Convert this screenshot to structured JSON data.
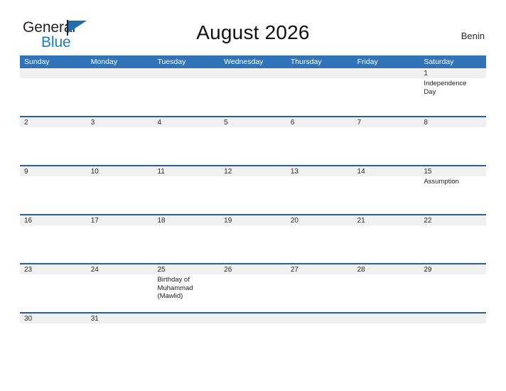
{
  "branding": {
    "logo_primary": "General",
    "logo_secondary": "Blue",
    "color_primary": "#231f20",
    "color_secondary": "#1a7dc4",
    "flag_color": "#1f6cb0"
  },
  "header": {
    "title": "August 2026",
    "country": "Benin"
  },
  "colors": {
    "header_blue": "#3173b8",
    "separator_blue": "#2a5f9e",
    "date_band_gray": "#f0f0f0"
  },
  "calendar": {
    "weekdays": [
      "Sunday",
      "Monday",
      "Tuesday",
      "Wednesday",
      "Thursday",
      "Friday",
      "Saturday"
    ],
    "weeks": [
      {
        "short": false,
        "days": [
          {
            "num": "",
            "event": ""
          },
          {
            "num": "",
            "event": ""
          },
          {
            "num": "",
            "event": ""
          },
          {
            "num": "",
            "event": ""
          },
          {
            "num": "",
            "event": ""
          },
          {
            "num": "",
            "event": ""
          },
          {
            "num": "1",
            "event": "Independence Day"
          }
        ]
      },
      {
        "short": false,
        "days": [
          {
            "num": "2",
            "event": ""
          },
          {
            "num": "3",
            "event": ""
          },
          {
            "num": "4",
            "event": ""
          },
          {
            "num": "5",
            "event": ""
          },
          {
            "num": "6",
            "event": ""
          },
          {
            "num": "7",
            "event": ""
          },
          {
            "num": "8",
            "event": ""
          }
        ]
      },
      {
        "short": false,
        "days": [
          {
            "num": "9",
            "event": ""
          },
          {
            "num": "10",
            "event": ""
          },
          {
            "num": "11",
            "event": ""
          },
          {
            "num": "12",
            "event": ""
          },
          {
            "num": "13",
            "event": ""
          },
          {
            "num": "14",
            "event": ""
          },
          {
            "num": "15",
            "event": "Assumption"
          }
        ]
      },
      {
        "short": false,
        "days": [
          {
            "num": "16",
            "event": ""
          },
          {
            "num": "17",
            "event": ""
          },
          {
            "num": "18",
            "event": ""
          },
          {
            "num": "19",
            "event": ""
          },
          {
            "num": "20",
            "event": ""
          },
          {
            "num": "21",
            "event": ""
          },
          {
            "num": "22",
            "event": ""
          }
        ]
      },
      {
        "short": false,
        "days": [
          {
            "num": "23",
            "event": ""
          },
          {
            "num": "24",
            "event": ""
          },
          {
            "num": "25",
            "event": "Birthday of Muhammad (Mawlid)"
          },
          {
            "num": "26",
            "event": ""
          },
          {
            "num": "27",
            "event": ""
          },
          {
            "num": "28",
            "event": ""
          },
          {
            "num": "29",
            "event": ""
          }
        ]
      },
      {
        "short": true,
        "days": [
          {
            "num": "30",
            "event": ""
          },
          {
            "num": "31",
            "event": ""
          },
          {
            "num": "",
            "event": ""
          },
          {
            "num": "",
            "event": ""
          },
          {
            "num": "",
            "event": ""
          },
          {
            "num": "",
            "event": ""
          },
          {
            "num": "",
            "event": ""
          }
        ]
      }
    ]
  }
}
